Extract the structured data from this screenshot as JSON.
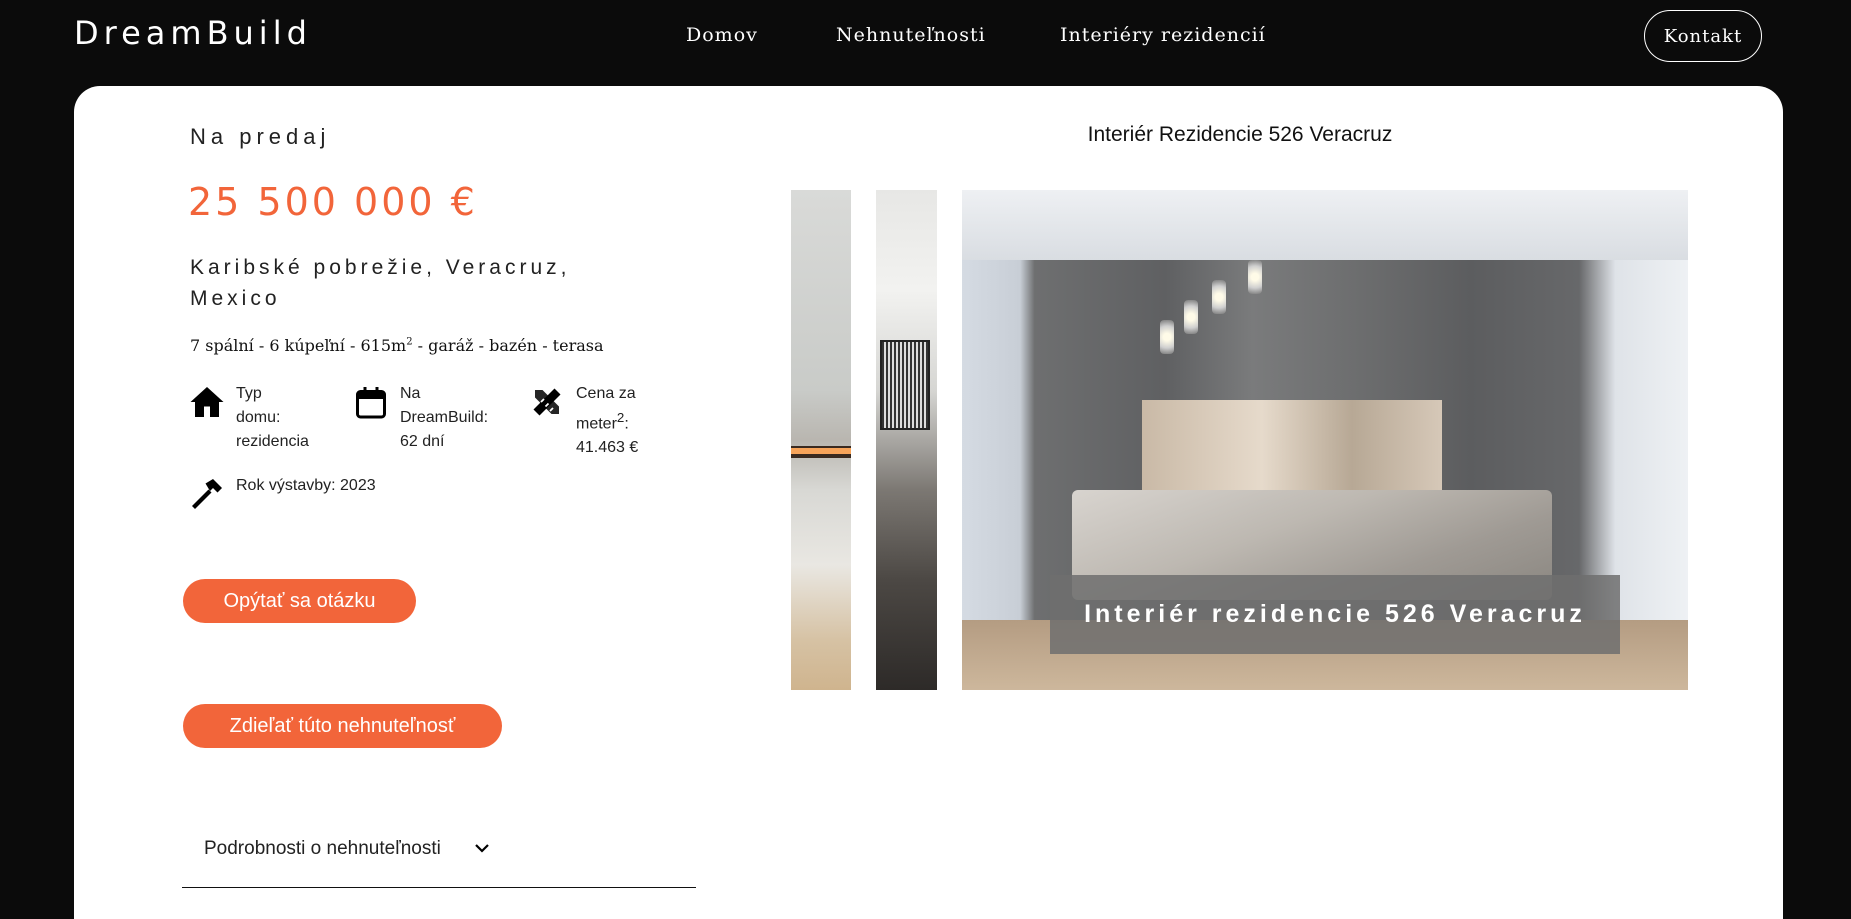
{
  "header": {
    "brand": "DreamBuild",
    "nav": [
      {
        "label": "Domov"
      },
      {
        "label": "Nehnuteľnosti"
      },
      {
        "label": "Interiéry rezidencií"
      }
    ],
    "contact_label": "Kontakt"
  },
  "listing": {
    "status": "Na predaj",
    "price": "25 500 000 €",
    "location": "Karibské pobrežie, Veracruz, Mexico",
    "features_pre": "7 spální - 6 kúpeľní - 615m",
    "features_sup": "2",
    "features_post": " - garáž - bazén - terasa",
    "type_text": "Typ\ndomu:\nrezidencia",
    "days_text": "Na\nDreamBuild:\n62 dní",
    "price_per_m2_pre": "Cena za\nmeter",
    "price_per_m2_sup": "2",
    "price_per_m2_post": ":\n41.463 €",
    "year_text": "Rok výstavby: 2023",
    "ask_button": "Opýtať sa otázku",
    "share_button": "Zdieľať túto nehnuteľnosť",
    "details_label": "Podrobnosti o nehnuteľnosti"
  },
  "gallery": {
    "title": "Interiér Rezidencie 526 Veracruz",
    "caption": "Interiér rezidencie 526 Veracruz"
  },
  "colors": {
    "accent": "#f2653a",
    "background": "#0b0b0b",
    "card": "#ffffff"
  },
  "icons": {
    "type": "house-icon",
    "days": "calendar-icon",
    "price": "ruler-pencil-icon",
    "year": "hammer-icon",
    "details": "chevron-down-icon"
  }
}
